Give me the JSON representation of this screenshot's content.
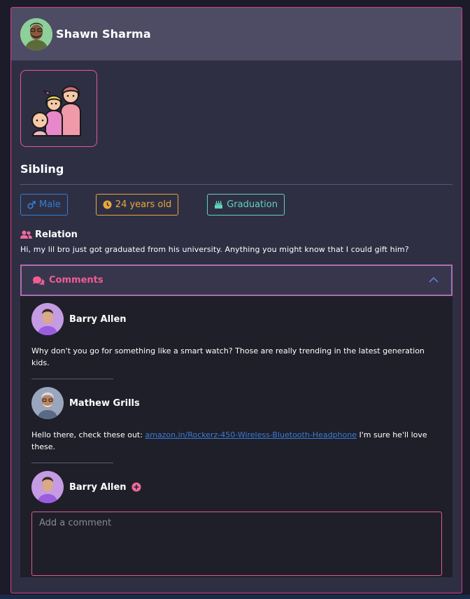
{
  "header": {
    "user_name": "Shawn Sharma"
  },
  "category": {
    "title": "Sibling",
    "image_icon": "family-illustration"
  },
  "badges": {
    "gender": "Male",
    "age": "24 years old",
    "occasion": "Graduation"
  },
  "relation": {
    "label": "Relation",
    "text": "Hi, my lil bro just got graduated from his university. Anything you might know that I could gift him?"
  },
  "comments_section": {
    "label": "Comments",
    "items": [
      {
        "author": "Barry Allen",
        "text": "Why don't you go for something like a smart watch? Those are really trending in the latest generation kids."
      },
      {
        "author": "Mathew Grills",
        "text_before": "Hello there, check these out: ",
        "link": "amazon.in/Rockerz-450-Wireless-Bluetooth-Headphone",
        "text_after": " I'm sure he'll love these."
      }
    ],
    "composer": {
      "author": "Barry Allen",
      "placeholder": "Add a comment"
    }
  },
  "colors": {
    "accent": "#e15b8f",
    "male": "#2f7fd6",
    "age": "#e9a93a",
    "graduation": "#5fd4b8",
    "link": "#3a7bd5"
  }
}
